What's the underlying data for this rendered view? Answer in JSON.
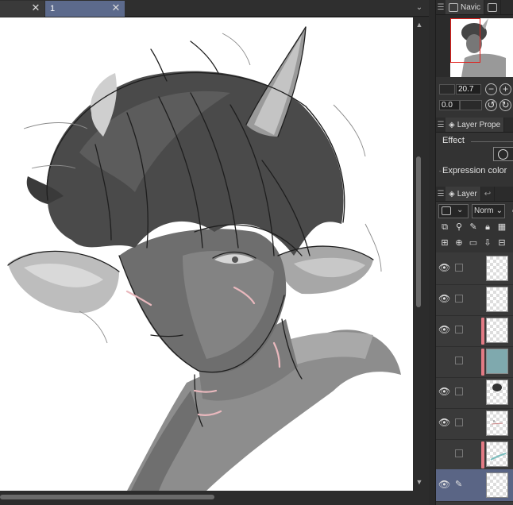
{
  "document_tabs": [
    {
      "label": "",
      "active": false
    },
    {
      "label": "1",
      "active": true
    }
  ],
  "navigator": {
    "tab_label": "Navic",
    "zoom": "20.7",
    "rotation": "0.0"
  },
  "layer_property": {
    "tab_label": "Layer Prope",
    "effect_label": "Effect",
    "expression_color_label": "Expression color"
  },
  "layer_panel": {
    "tab_label": "Layer",
    "blend_mode": "Norm",
    "layers": [
      {
        "visible": true,
        "clipped": false,
        "thumb": "checker",
        "active": false
      },
      {
        "visible": true,
        "clipped": false,
        "thumb": "checker",
        "active": false
      },
      {
        "visible": true,
        "clipped": true,
        "thumb": "checker",
        "active": false
      },
      {
        "visible": false,
        "clipped": true,
        "thumb": "teal",
        "active": false
      },
      {
        "visible": true,
        "clipped": false,
        "thumb": "hair",
        "active": false
      },
      {
        "visible": true,
        "clipped": false,
        "thumb": "dots",
        "active": false
      },
      {
        "visible": false,
        "clipped": true,
        "thumb": "mint",
        "active": false
      },
      {
        "visible": true,
        "clipped": false,
        "thumb": "checker",
        "active": true
      }
    ]
  },
  "colors": {
    "active_tab": "#5c6a8c",
    "clip_marker": "#e27a84",
    "navigator_frame": "#e0201c",
    "teal_layer": "#7fa9ae"
  }
}
